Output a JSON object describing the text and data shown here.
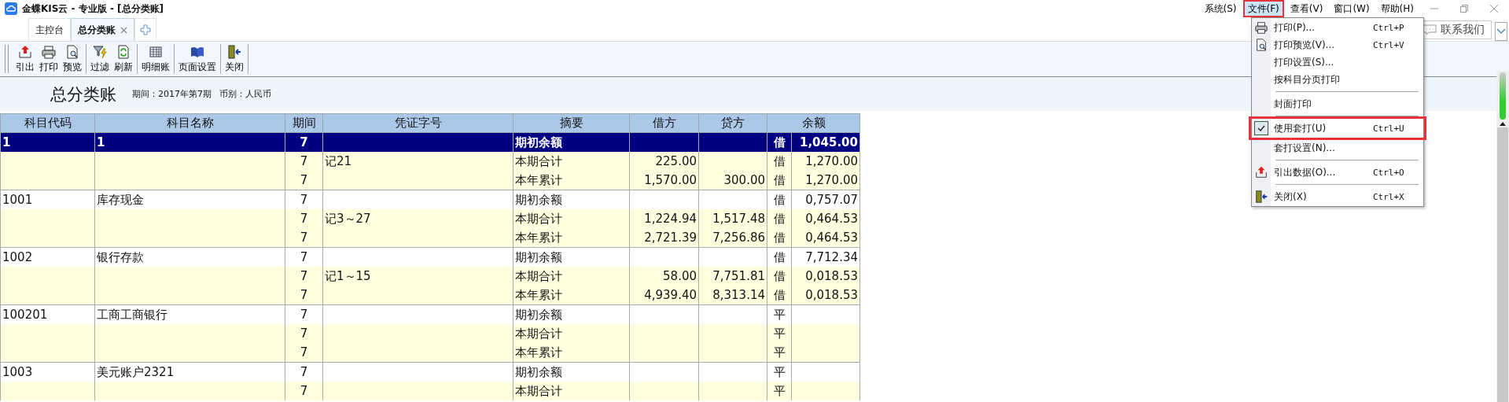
{
  "window": {
    "title": "金蝶KIS云 - 专业版 - [总分类账]"
  },
  "menu_bar": [
    {
      "label": "系统(S)",
      "highlighted": false
    },
    {
      "label": "文件(F)",
      "highlighted": true
    },
    {
      "label": "查看(V)",
      "highlighted": false
    },
    {
      "label": "窗口(W)",
      "highlighted": false
    },
    {
      "label": "帮助(H)",
      "highlighted": false
    }
  ],
  "tabs": [
    {
      "label": "主控台",
      "selected": false
    },
    {
      "label": "总分类账",
      "selected": true
    }
  ],
  "contact_button": "联系我们",
  "toolbar": [
    [
      {
        "kind": "export",
        "label": "引出"
      },
      {
        "kind": "print",
        "label": "打印"
      },
      {
        "kind": "preview",
        "label": "预览"
      }
    ],
    [
      {
        "kind": "filter",
        "label": "过滤"
      },
      {
        "kind": "refresh",
        "label": "刷新"
      }
    ],
    [
      {
        "kind": "detail",
        "label": "明细账"
      }
    ],
    [
      {
        "kind": "page",
        "label": "页面设置"
      }
    ],
    [
      {
        "kind": "close",
        "label": "关闭"
      }
    ]
  ],
  "report": {
    "title": "总分类账",
    "period": "期间：2017年第7期",
    "currency": "币别：人民币"
  },
  "table": {
    "columns": [
      "科目代码",
      "科目名称",
      "期间",
      "凭证字号",
      "摘要",
      "借方",
      "贷方",
      "余额"
    ],
    "groups": [
      {
        "code": "1",
        "name": "1",
        "rows": [
          {
            "period": "7",
            "voucher": "",
            "summary": "期初余额",
            "debit": "",
            "credit": "",
            "direction": "借",
            "balance": "1,045.00",
            "selected": true
          },
          {
            "period": "7",
            "voucher": "记21",
            "summary": "本期合计",
            "debit": "225.00",
            "credit": "",
            "direction": "借",
            "balance": "1,270.00",
            "selected": false
          },
          {
            "period": "7",
            "voucher": "",
            "summary": "本年累计",
            "debit": "1,570.00",
            "credit": "300.00",
            "direction": "借",
            "balance": "1,270.00",
            "selected": false
          }
        ]
      },
      {
        "code": "1001",
        "name": "库存现金",
        "rows": [
          {
            "period": "7",
            "voucher": "",
            "summary": "期初余额",
            "debit": "",
            "credit": "",
            "direction": "借",
            "balance": "0,757.07",
            "selected": false
          },
          {
            "period": "7",
            "voucher": "记3～27",
            "summary": "本期合计",
            "debit": "1,224.94",
            "credit": "1,517.48",
            "direction": "借",
            "balance": "0,464.53",
            "selected": false
          },
          {
            "period": "7",
            "voucher": "",
            "summary": "本年累计",
            "debit": "2,721.39",
            "credit": "7,256.86",
            "direction": "借",
            "balance": "0,464.53",
            "selected": false
          }
        ]
      },
      {
        "code": "1002",
        "name": "银行存款",
        "rows": [
          {
            "period": "7",
            "voucher": "",
            "summary": "期初余额",
            "debit": "",
            "credit": "",
            "direction": "借",
            "balance": "7,712.34",
            "selected": false
          },
          {
            "period": "7",
            "voucher": "记1～15",
            "summary": "本期合计",
            "debit": "58.00",
            "credit": "7,751.81",
            "direction": "借",
            "balance": "0,018.53",
            "selected": false
          },
          {
            "period": "7",
            "voucher": "",
            "summary": "本年累计",
            "debit": "4,939.40",
            "credit": "8,313.14",
            "direction": "借",
            "balance": "0,018.53",
            "selected": false
          }
        ]
      },
      {
        "code": "100201",
        "name": "工商工商银行",
        "rows": [
          {
            "period": "7",
            "voucher": "",
            "summary": "期初余额",
            "debit": "",
            "credit": "",
            "direction": "平",
            "balance": "",
            "selected": false
          },
          {
            "period": "7",
            "voucher": "",
            "summary": "本期合计",
            "debit": "",
            "credit": "",
            "direction": "平",
            "balance": "",
            "selected": false
          },
          {
            "period": "7",
            "voucher": "",
            "summary": "本年累计",
            "debit": "",
            "credit": "",
            "direction": "平",
            "balance": "",
            "selected": false
          }
        ]
      },
      {
        "code": "1003",
        "name": "美元账户2321",
        "rows": [
          {
            "period": "7",
            "voucher": "",
            "summary": "期初余额",
            "debit": "",
            "credit": "",
            "direction": "平",
            "balance": "",
            "selected": false
          },
          {
            "period": "7",
            "voucher": "",
            "summary": "本期合计",
            "debit": "",
            "credit": "",
            "direction": "平",
            "balance": "",
            "selected": false
          }
        ]
      }
    ]
  },
  "file_menu": [
    {
      "kind": "print",
      "label": "打印(P)...",
      "shortcut": "Ctrl+P",
      "checked": false,
      "highlighted": false
    },
    {
      "kind": "preview",
      "label": "打印预览(V)...",
      "shortcut": "Ctrl+V",
      "checked": false,
      "highlighted": false
    },
    {
      "kind": "plain",
      "label": "打印设置(S)...",
      "checked": false,
      "highlighted": false
    },
    {
      "kind": "plain",
      "label": "按科目分页打印",
      "checked": false,
      "highlighted": false
    },
    {
      "kind": "separator"
    },
    {
      "kind": "plain",
      "label": "封面打印",
      "checked": false,
      "highlighted": false
    },
    {
      "kind": "separator"
    },
    {
      "kind": "plain",
      "label": "使用套打(U)",
      "shortcut": "Ctrl+U",
      "checked": true,
      "highlighted": true
    },
    {
      "kind": "plain",
      "label": "套打设置(N)...",
      "checked": false,
      "highlighted": false
    },
    {
      "kind": "separator"
    },
    {
      "kind": "export",
      "label": "引出数据(O)...",
      "shortcut": "Ctrl+O",
      "checked": false,
      "highlighted": false
    },
    {
      "kind": "separator"
    },
    {
      "kind": "close",
      "label": "关闭(X)",
      "shortcut": "Ctrl+X",
      "checked": false,
      "highlighted": false
    }
  ]
}
